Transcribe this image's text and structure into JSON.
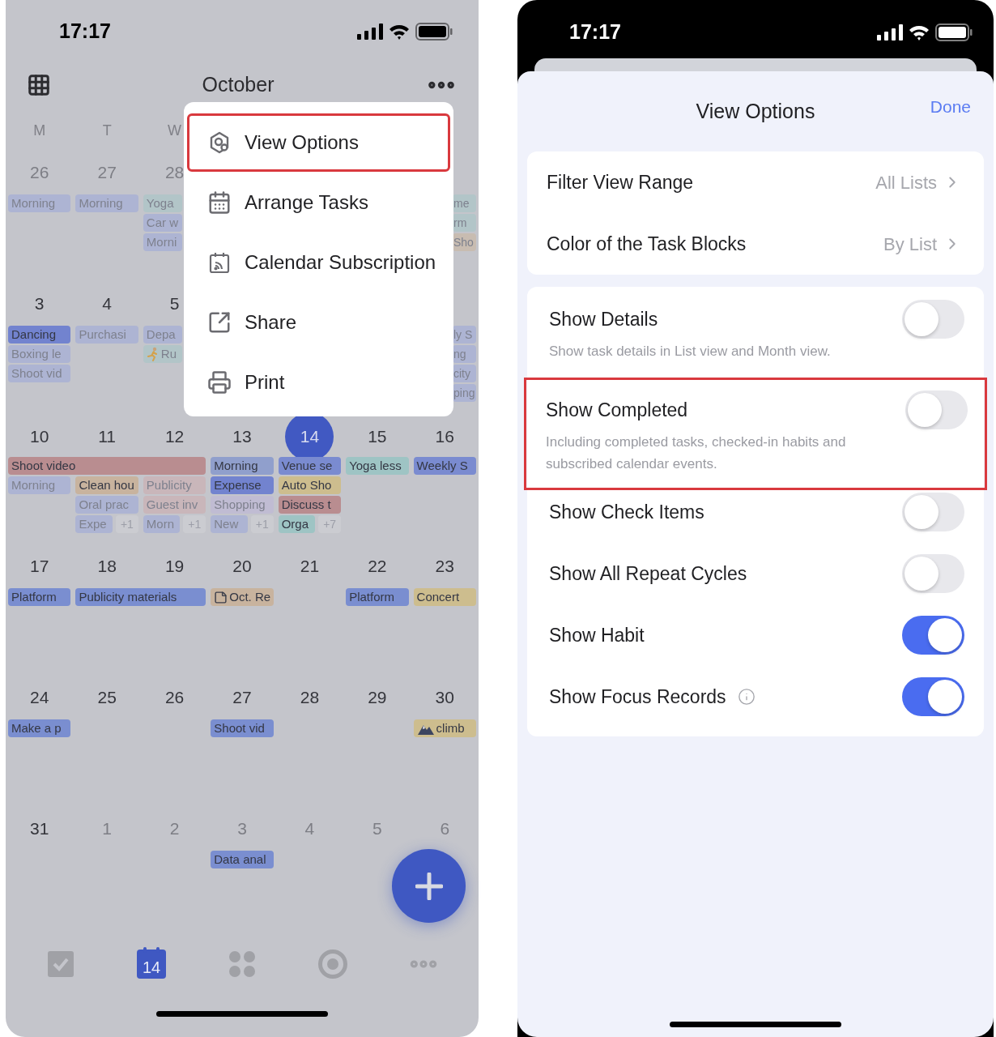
{
  "left": {
    "status_bar": {
      "time": "17:17"
    },
    "header": {
      "title": "October"
    },
    "weekdays": [
      "M",
      "T",
      "W"
    ],
    "weeks": [
      {
        "days_before_menu": [
          {
            "date": "26",
            "other_month": true,
            "selected": false,
            "events": [
              {
                "kind": "task",
                "text": "Morning",
                "color": "#adb4d3",
                "faded": true
              }
            ]
          },
          {
            "date": "27",
            "other_month": true,
            "selected": false,
            "events": [
              {
                "kind": "task",
                "text": "Morning",
                "color": "#adb4d3",
                "faded": true
              }
            ]
          },
          {
            "date": "28",
            "other_month": true,
            "selected": false,
            "events": [
              {
                "kind": "task",
                "text": "Yoga",
                "color": "#b2c5c8",
                "faded": true
              },
              {
                "kind": "task",
                "text": "Car w",
                "color": "#adb4d3",
                "faded": true
              },
              {
                "kind": "task",
                "text": "Morni",
                "color": "#adb4d3",
                "faded": true
              }
            ]
          }
        ],
        "days_after_menu": [
          {
            "events": [
              {
                "kind": "task",
                "text": "me",
                "color": "#b2c5c8",
                "faded": true
              },
              {
                "kind": "task",
                "text": "rm",
                "color": "#b2c5c8",
                "faded": true
              },
              {
                "kind": "task",
                "text": "Sho",
                "color": "#c8bcb1",
                "faded": true
              }
            ]
          }
        ]
      },
      {
        "days_before_menu": [
          {
            "date": "3",
            "other_month": false,
            "selected": false,
            "events": [
              {
                "kind": "task",
                "text": "Dancing",
                "color": "#7283cf",
                "faded": false
              },
              {
                "kind": "task",
                "text": "Boxing le",
                "color": "#adb4d3",
                "faded": true
              },
              {
                "kind": "task",
                "text": "Shoot vid",
                "color": "#adb4d3",
                "faded": true
              }
            ]
          },
          {
            "date": "4",
            "other_month": false,
            "selected": false,
            "events": [
              {
                "kind": "task",
                "text": "Purchasi",
                "color": "#adb4d3",
                "faded": true
              }
            ]
          },
          {
            "date": "5",
            "other_month": false,
            "selected": false,
            "events": [
              {
                "kind": "task",
                "text": "Depa",
                "color": "#adb4d3",
                "faded": true
              },
              {
                "kind": "run",
                "text": "Ru",
                "color": "#b2c5c8",
                "faded": true
              }
            ]
          }
        ],
        "days_after_menu": [
          {
            "events": [
              {
                "kind": "task",
                "text": "ly S",
                "color": "#adb4d3",
                "faded": true
              },
              {
                "kind": "task",
                "text": "ng",
                "color": "#adb4d3",
                "faded": true
              },
              {
                "kind": "task",
                "text": "city",
                "color": "#adb4d3",
                "faded": true
              },
              {
                "kind": "task",
                "text": "ping",
                "color": "#adb4d3",
                "faded": true
              }
            ]
          }
        ]
      },
      {
        "days": [
          {
            "date": "10",
            "other_month": false,
            "selected": false,
            "events": [
              {
                "kind": "task",
                "text": "Shoot video",
                "color": "#b98d90",
                "faded": false
              },
              {
                "kind": "task",
                "text": "Morning",
                "color": "#adb4d3",
                "faded": true
              }
            ]
          },
          {
            "date": "11",
            "other_month": false,
            "selected": false,
            "events": [
              {
                "kind": "continued"
              },
              {
                "kind": "task",
                "text": "Clean hou",
                "color": "#c8b39e",
                "faded": false
              },
              {
                "kind": "task",
                "text": "Oral prac",
                "color": "#adb4d3",
                "faded": true
              },
              {
                "kind": "task",
                "text": "Expe",
                "more": "+1",
                "color": "#adb4d3",
                "faded": true
              }
            ]
          },
          {
            "date": "12",
            "other_month": false,
            "selected": false,
            "events": [
              {
                "kind": "continued"
              },
              {
                "kind": "task",
                "text": "Publicity",
                "color": "#c9b6ba",
                "faded": true
              },
              {
                "kind": "task",
                "text": "Guest inv",
                "color": "#c9b6ba",
                "faded": true
              },
              {
                "kind": "task",
                "text": "Morn",
                "more": "+1",
                "color": "#adb4d3",
                "faded": true
              }
            ]
          },
          {
            "date": "13",
            "other_month": false,
            "selected": false,
            "events": [
              {
                "kind": "task",
                "text": "Morning",
                "color": "#909fcc",
                "faded": false
              },
              {
                "kind": "task",
                "text": "Expense",
                "color": "#7283cf",
                "faded": false
              },
              {
                "kind": "task",
                "text": "Shopping",
                "color": "#c0bcd3",
                "faded": true
              },
              {
                "kind": "task",
                "text": "New",
                "more": "+1",
                "color": "#adb4d3",
                "faded": true
              }
            ]
          },
          {
            "date": "14",
            "other_month": false,
            "selected": true,
            "events": [
              {
                "kind": "task",
                "text": "Venue se",
                "color": "#7a8bd0",
                "faded": false
              },
              {
                "kind": "task",
                "text": "Auto Sho",
                "color": "#cdbd8e",
                "faded": false
              },
              {
                "kind": "task",
                "text": "Discuss t",
                "color": "#b98d90",
                "faded": false
              },
              {
                "kind": "task",
                "text": "Orga",
                "more": "+7",
                "color": "#9ec4c4",
                "faded": false
              }
            ]
          },
          {
            "date": "15",
            "other_month": false,
            "selected": false,
            "events": [
              {
                "kind": "task",
                "text": "Yoga less",
                "color": "#9ec4c4",
                "faded": false
              }
            ]
          },
          {
            "date": "16",
            "other_month": false,
            "selected": false,
            "events": [
              {
                "kind": "task",
                "text": "Weekly S",
                "color": "#7a8bd0",
                "faded": false
              }
            ]
          }
        ]
      },
      {
        "days": [
          {
            "date": "17",
            "other_month": false,
            "selected": false,
            "events": [
              {
                "kind": "task",
                "text": "Platform",
                "color": "#7a8ed0",
                "faded": false
              }
            ]
          },
          {
            "date": "18",
            "other_month": false,
            "selected": false,
            "events": [
              {
                "kind": "task",
                "text": "Publicity materials",
                "color": "#7a8ed0",
                "faded": false
              }
            ]
          },
          {
            "date": "19",
            "other_month": false,
            "selected": false,
            "events": [
              {
                "kind": "continued"
              }
            ]
          },
          {
            "date": "20",
            "other_month": false,
            "selected": false,
            "events": [
              {
                "kind": "note",
                "text": "Oct. Re",
                "color": "#c8b39e",
                "faded": false
              }
            ]
          },
          {
            "date": "21",
            "other_month": false,
            "selected": false
          },
          {
            "date": "22",
            "other_month": false,
            "selected": false,
            "events": [
              {
                "kind": "task",
                "text": "Platform",
                "color": "#7a8ed0",
                "faded": false
              }
            ]
          },
          {
            "date": "23",
            "other_month": false,
            "selected": false,
            "events": [
              {
                "kind": "task",
                "text": "Concert",
                "color": "#cdbd8e",
                "faded": false
              }
            ]
          }
        ]
      },
      {
        "days": [
          {
            "date": "24",
            "other_month": false,
            "selected": false,
            "events": [
              {
                "kind": "task",
                "text": "Make a p",
                "color": "#7a8ed0",
                "faded": false
              }
            ]
          },
          {
            "date": "25",
            "other_month": false,
            "selected": false
          },
          {
            "date": "26",
            "other_month": false,
            "selected": false
          },
          {
            "date": "27",
            "other_month": false,
            "selected": false,
            "events": [
              {
                "kind": "task",
                "text": "Shoot vid",
                "color": "#7a8ed0",
                "faded": false
              }
            ]
          },
          {
            "date": "28",
            "other_month": false,
            "selected": false
          },
          {
            "date": "29",
            "other_month": false,
            "selected": false
          },
          {
            "date": "30",
            "other_month": false,
            "selected": false,
            "events": [
              {
                "kind": "climb",
                "text": "climb",
                "color": "#cdbd8e",
                "faded": false
              }
            ]
          }
        ]
      },
      {
        "days": [
          {
            "date": "31",
            "other_month": false,
            "selected": false
          },
          {
            "date": "1",
            "other_month": true,
            "selected": false
          },
          {
            "date": "2",
            "other_month": true,
            "selected": false
          },
          {
            "date": "3",
            "other_month": true,
            "selected": false,
            "events": [
              {
                "kind": "task",
                "text": "Data anal",
                "color": "#7a8ed0",
                "faded": false
              }
            ]
          },
          {
            "date": "4",
            "other_month": true,
            "selected": false
          },
          {
            "date": "5",
            "other_month": true,
            "selected": false
          },
          {
            "date": "6",
            "other_month": true,
            "selected": false
          }
        ]
      }
    ],
    "menu": {
      "items": [
        {
          "label": "View Options",
          "highlighted": true
        },
        {
          "label": "Arrange Tasks",
          "highlighted": false
        },
        {
          "label": "Calendar Subscription",
          "highlighted": false
        },
        {
          "label": "Share",
          "highlighted": false
        },
        {
          "label": "Print",
          "highlighted": false
        }
      ]
    },
    "tab_bar": [
      {
        "selected": false
      },
      {
        "label": "14",
        "selected": true
      },
      {
        "selected": false
      },
      {
        "selected": false
      },
      {
        "selected": false
      }
    ]
  },
  "right": {
    "status_bar": {
      "time": "17:17"
    },
    "sheet": {
      "title": "View Options",
      "done": "Done",
      "links": [
        {
          "label": "Filter View Range",
          "value": "All Lists"
        },
        {
          "label": "Color of the Task Blocks",
          "value": "By List"
        }
      ],
      "toggles": [
        {
          "label": "Show Details",
          "description": "Show task details in List view and Month view.",
          "on": false,
          "highlighted": false,
          "info": false
        },
        {
          "label": "Show Completed",
          "description": "Including completed tasks, checked-in habits and subscribed calendar events.",
          "on": false,
          "highlighted": true,
          "info": false
        },
        {
          "label": "Show Check Items",
          "on": false,
          "highlighted": false,
          "info": false
        },
        {
          "label": "Show All Repeat Cycles",
          "on": false,
          "highlighted": false,
          "info": false
        },
        {
          "label": "Show Habit",
          "on": true,
          "highlighted": false,
          "info": false
        },
        {
          "label": "Show Focus Records",
          "on": true,
          "highlighted": false,
          "info": true
        }
      ]
    }
  }
}
